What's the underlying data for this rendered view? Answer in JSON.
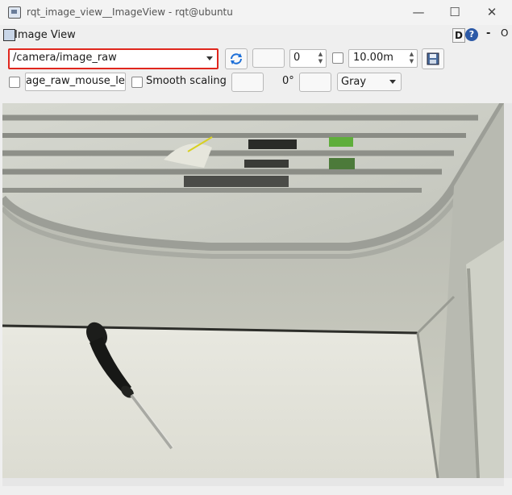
{
  "window": {
    "title": "rqt_image_view__ImageView - rqt@ubuntu"
  },
  "dock": {
    "title": "Image View",
    "d_label": "D",
    "help_label": "?",
    "dash_label": "-",
    "o_label": "O"
  },
  "toolbar": {
    "topic": "/camera/image_raw",
    "number_value": "0",
    "max_value": "10.00m",
    "mouse_topic": "age_raw_mouse_left",
    "smooth_label": "Smooth scaling",
    "rotation": "0°",
    "color_mode": "Gray"
  },
  "icons": [
    "app-icon",
    "refresh-icon",
    "save-icon",
    "help-icon",
    "minimize-icon",
    "maximize-icon",
    "close-icon"
  ]
}
